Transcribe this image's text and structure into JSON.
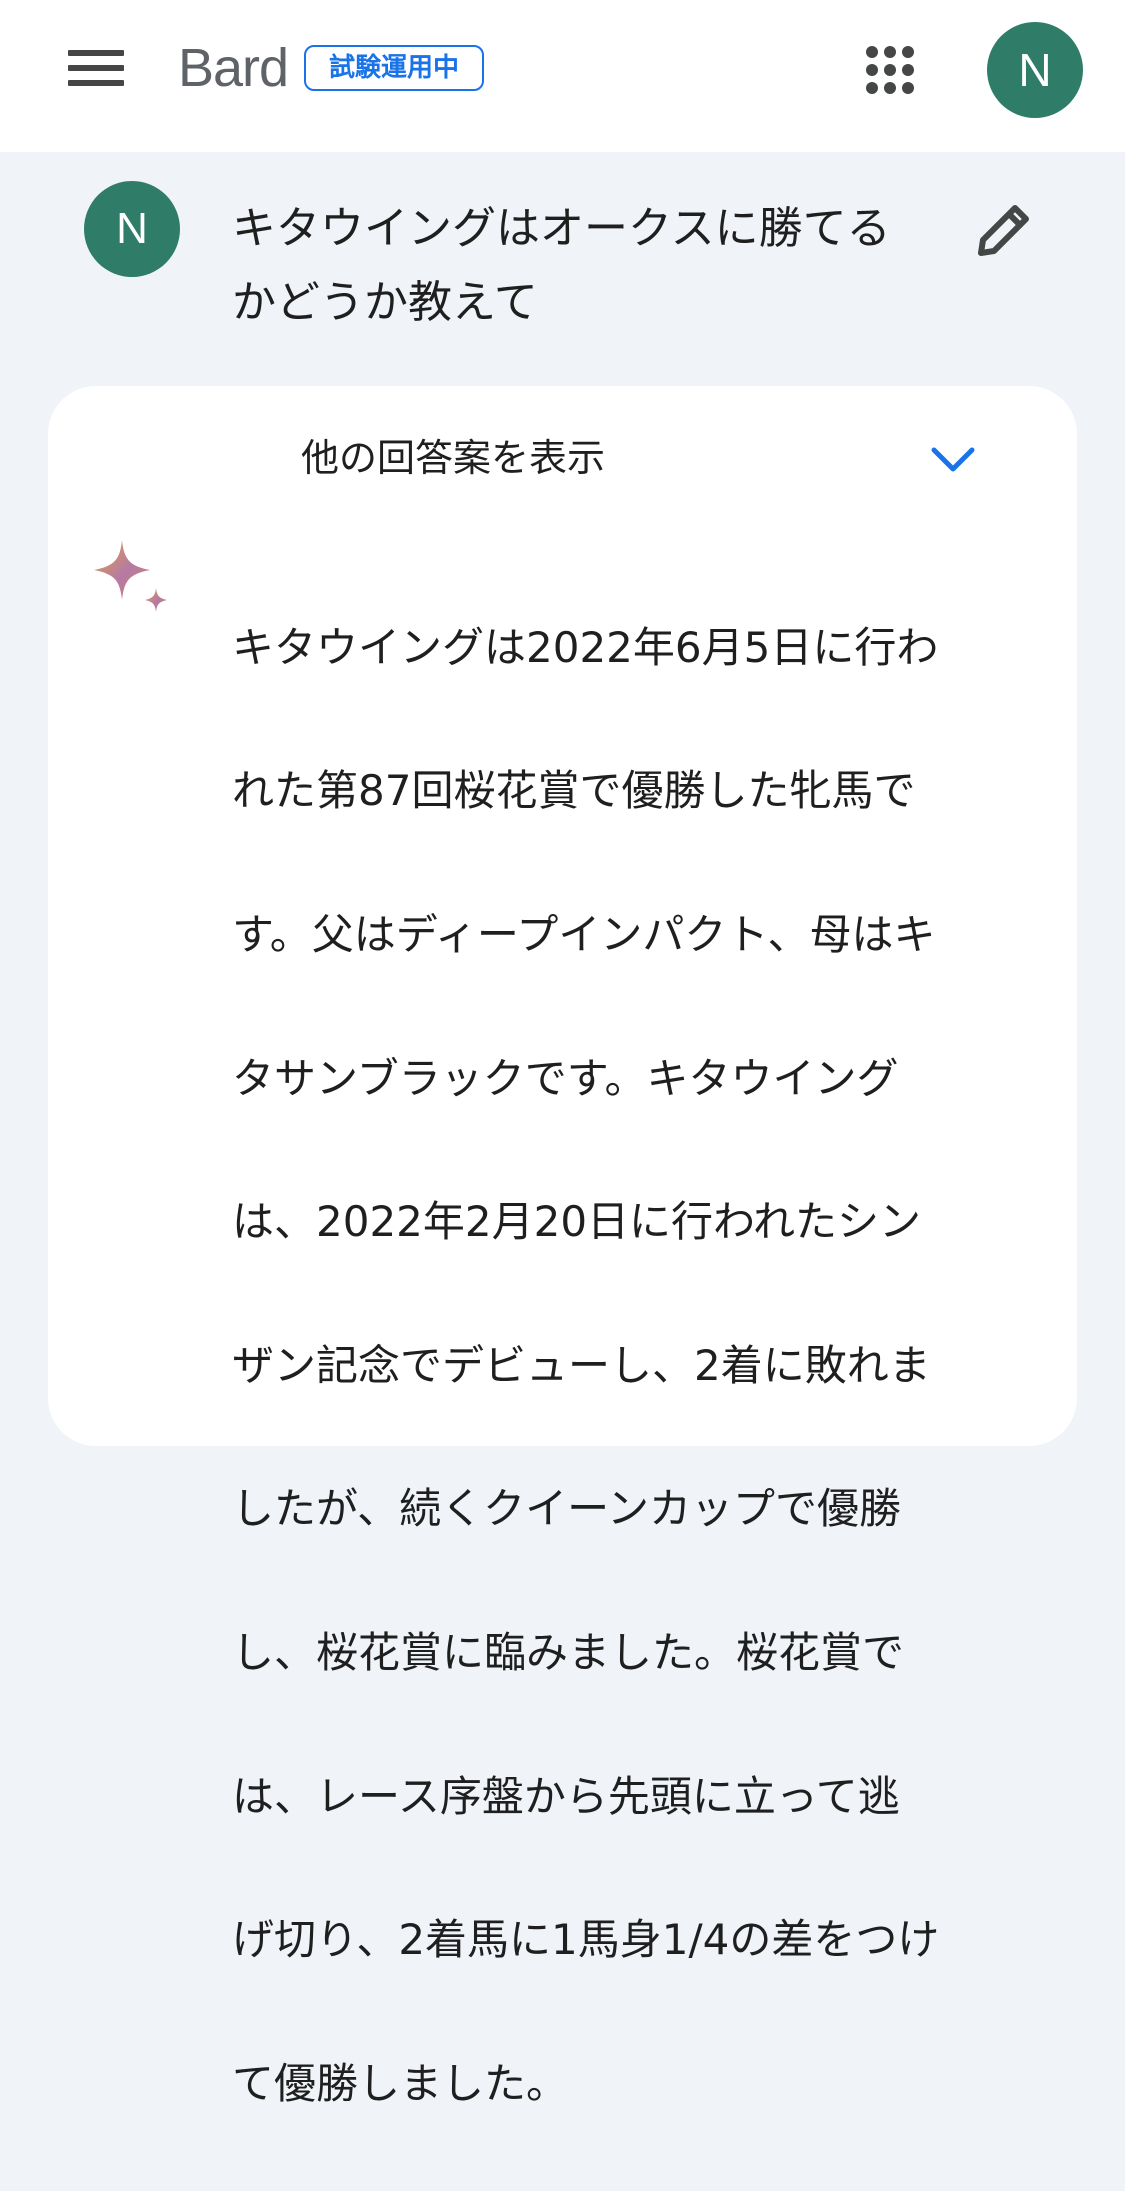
{
  "header": {
    "menu_icon": "hamburger-menu-icon",
    "logo": "Bard",
    "badge": "試験運用中",
    "apps_icon": "apps-grid-icon",
    "account_initial": "N"
  },
  "prompt": {
    "user_initial": "N",
    "text": "キタウイングはオークスに勝てるかどうか教えて",
    "edit_icon": "pencil-edit-icon"
  },
  "response": {
    "drafts_label": "他の回答案を表示",
    "chevron_icon": "chevron-down-icon",
    "bard_icon": "sparkle-icon",
    "lines": [
      "キタウイングは2022年6月5日に行わ",
      "れた第87回桜花賞で優勝した牝馬で",
      "す。父はディープインパクト、母はキ",
      "タサンブラックです。キタウイング",
      "は、2022年2月20日に行われたシン",
      "ザン記念でデビューし、2着に敗れま",
      "したが、続くクイーンカップで優勝",
      "し、桜花賞に臨みました。桜花賞で",
      "は、レース序盤から先頭に立って逃",
      "げ切り、2着馬に1馬身1/4の差をつけ",
      "て優勝しました。"
    ]
  },
  "colors": {
    "page_bg": "#f0f4f9",
    "avatar": "#2f7d68",
    "accent": "#1a73e8"
  }
}
